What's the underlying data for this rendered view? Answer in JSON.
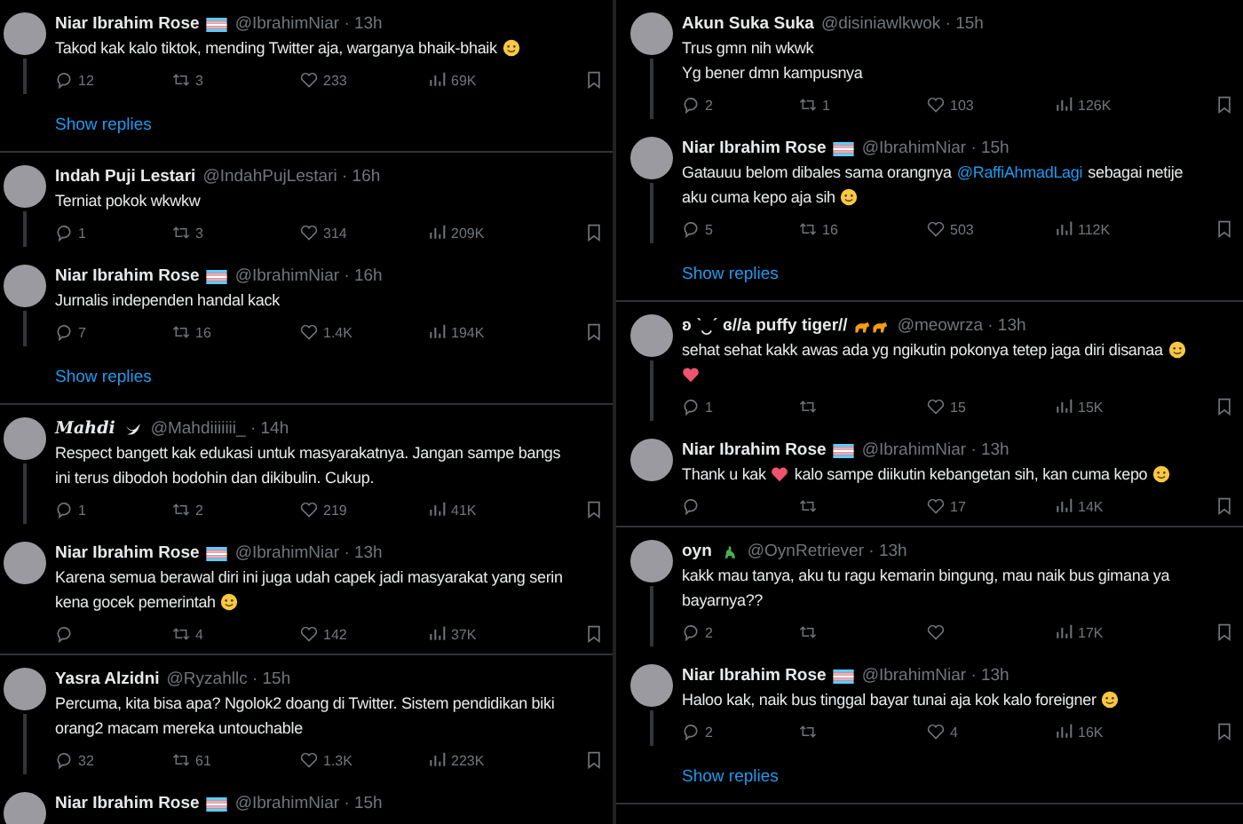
{
  "panels": [
    {
      "threads": [
        {
          "tweets": [
            {
              "name": "Niar Ibrahim Rose",
              "badge": {
                "kind": "flag"
              },
              "meta": "@IbrahimNiar · 13h",
              "lines": [
                [
                  {
                    "kind": "text",
                    "text": "Takod kak kalo tiktok, mending Twitter aja, warganya bhaik-bhaik"
                  },
                  {
                    "kind": "face-emoji"
                  }
                ]
              ],
              "stats": {
                "replies": "12",
                "reposts": "3",
                "likes": "233",
                "views": "69K"
              }
            }
          ],
          "show_replies": "Show replies"
        },
        {
          "tweets": [
            {
              "name": "Indah Puji Lestari",
              "meta": "@IndahPujLestari · 16h",
              "lines": [
                [
                  {
                    "kind": "text",
                    "text": "Terniat pokok wkwkw"
                  }
                ]
              ],
              "stats": {
                "replies": "1",
                "reposts": "3",
                "likes": "314",
                "views": "209K"
              }
            },
            {
              "name": "Niar Ibrahim Rose",
              "badge": {
                "kind": "flag"
              },
              "meta": "@IbrahimNiar · 16h",
              "lines": [
                [
                  {
                    "kind": "text",
                    "text": "Jurnalis independen handal kack"
                  }
                ]
              ],
              "stats": {
                "replies": "7",
                "reposts": "16",
                "likes": "1.4K",
                "views": "194K"
              }
            }
          ],
          "show_replies": "Show replies"
        },
        {
          "tweets": [
            {
              "name": "Mahdi",
              "styled": true,
              "badge": {
                "kind": "bird"
              },
              "meta": "@Mahdiiiiiii_ · 14h",
              "lines": [
                [
                  {
                    "kind": "text",
                    "text": "Respect bangett kak edukasi untuk masyarakatnya. Jangan sampe bangs"
                  }
                ],
                [
                  {
                    "kind": "text",
                    "text": "ini terus dibodoh bodohin dan dikibulin. Cukup."
                  }
                ]
              ],
              "stats": {
                "replies": "1",
                "reposts": "2",
                "likes": "219",
                "views": "41K"
              }
            },
            {
              "name": "Niar Ibrahim Rose",
              "badge": {
                "kind": "flag"
              },
              "meta": "@IbrahimNiar · 13h",
              "lines": [
                [
                  {
                    "kind": "text",
                    "text": "Karena semua berawal diri ini juga udah capek jadi masyarakat yang serin"
                  }
                ],
                [
                  {
                    "kind": "text",
                    "text": "kena gocek pemerintah"
                  },
                  {
                    "kind": "face-emoji"
                  }
                ]
              ],
              "stats": {
                "reposts": "4",
                "likes": "142",
                "views": "37K"
              }
            }
          ]
        },
        {
          "tweets": [
            {
              "name": "Yasra Alzidni",
              "meta": "@Ryzahllc · 15h",
              "lines": [
                [
                  {
                    "kind": "text",
                    "text": "Percuma, kita bisa apa? Ngolok2 doang di Twitter. Sistem pendidikan biki"
                  }
                ],
                [
                  {
                    "kind": "text",
                    "text": "orang2 macam mereka untouchable"
                  }
                ]
              ],
              "stats": {
                "replies": "32",
                "reposts": "61",
                "likes": "1.3K",
                "views": "223K"
              }
            },
            {
              "name": "Niar Ibrahim Rose",
              "badge": {
                "kind": "flag"
              },
              "meta": "@IbrahimNiar · 15h"
            }
          ]
        }
      ]
    },
    {
      "threads": [
        {
          "tweets": [
            {
              "name": "Akun Suka Suka",
              "meta": "@disiniawlkwok · 15h",
              "lines": [
                [
                  {
                    "kind": "text",
                    "text": "Trus gmn nih wkwk"
                  }
                ],
                [
                  {
                    "kind": "text",
                    "text": "Yg bener dmn kampusnya"
                  }
                ]
              ],
              "stats": {
                "replies": "2",
                "reposts": "1",
                "likes": "103",
                "views": "126K"
              }
            },
            {
              "name": "Niar Ibrahim Rose",
              "badge": {
                "kind": "flag"
              },
              "meta": "@IbrahimNiar · 15h",
              "lines": [
                [
                  {
                    "kind": "text",
                    "text": "Gatauuu belom dibales sama orangnya"
                  },
                  {
                    "kind": "mention",
                    "text": "@RaffiAhmadLagi"
                  },
                  {
                    "kind": "text",
                    "text": "sebagai netije"
                  }
                ],
                [
                  {
                    "kind": "text",
                    "text": "aku cuma kepo aja sih"
                  },
                  {
                    "kind": "face-emoji"
                  }
                ]
              ],
              "stats": {
                "replies": "5",
                "reposts": "16",
                "likes": "503",
                "views": "112K"
              }
            }
          ],
          "show_replies": "Show replies"
        },
        {
          "tweets": [
            {
              "name": "ʚ ˋ‿ˊ ɞ//a puffy tiger//",
              "badge": {
                "kind": "tigers"
              },
              "meta": "@meowrza · 13h",
              "lines": [
                [
                  {
                    "kind": "text",
                    "text": "sehat sehat kakk awas ada yg ngikutin pokonya tetep jaga diri disanaa"
                  },
                  {
                    "kind": "face-emoji"
                  }
                ],
                [
                  {
                    "kind": "heart-emoji"
                  }
                ]
              ],
              "stats": {
                "replies": "1",
                "likes": "15",
                "views": "15K"
              }
            },
            {
              "name": "Niar Ibrahim Rose",
              "badge": {
                "kind": "flag"
              },
              "meta": "@IbrahimNiar · 13h",
              "lines": [
                [
                  {
                    "kind": "text",
                    "text": "Thank u kak"
                  },
                  {
                    "kind": "heart-emoji"
                  },
                  {
                    "kind": "text",
                    "text": "kalo sampe diikutin kebangetan sih, kan cuma kepo"
                  },
                  {
                    "kind": "face-emoji"
                  }
                ]
              ],
              "stats": {
                "likes": "17",
                "views": "14K"
              }
            }
          ]
        },
        {
          "tweets": [
            {
              "name": "oyn",
              "badge": {
                "kind": "dino"
              },
              "meta": "@OynRetriever · 13h",
              "lines": [
                [
                  {
                    "kind": "text",
                    "text": "kakk mau tanya, aku tu ragu kemarin bingung, mau naik bus gimana ya"
                  }
                ],
                [
                  {
                    "kind": "text",
                    "text": "bayarnya??"
                  }
                ]
              ],
              "stats": {
                "replies": "2",
                "views": "17K"
              }
            },
            {
              "name": "Niar Ibrahim Rose",
              "badge": {
                "kind": "flag"
              },
              "meta": "@IbrahimNiar · 13h",
              "lines": [
                [
                  {
                    "kind": "text",
                    "text": "Haloo kak, naik bus tinggal bayar tunai aja kok kalo foreigner"
                  },
                  {
                    "kind": "face-emoji"
                  }
                ]
              ],
              "stats": {
                "replies": "2",
                "likes": "4",
                "views": "16K"
              }
            }
          ],
          "show_replies": "Show replies"
        }
      ]
    }
  ]
}
